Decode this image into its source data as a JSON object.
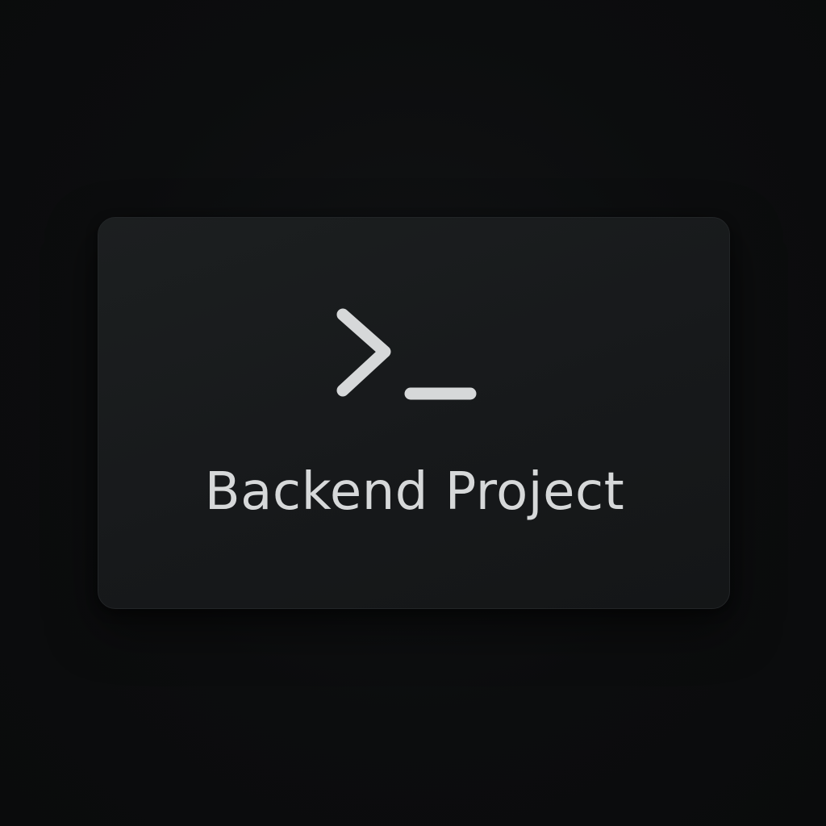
{
  "card": {
    "icon": "terminal-prompt-icon",
    "title": "Backend Project"
  },
  "colors": {
    "background": "#0c0d0e",
    "card": "#1a1c1e",
    "foreground": "#d6d8d9"
  }
}
